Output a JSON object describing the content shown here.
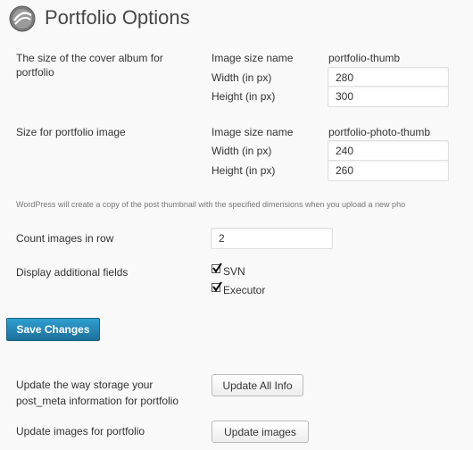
{
  "page": {
    "title": "Portfolio Options"
  },
  "cover": {
    "label": "The size of the cover album for portfolio",
    "image_size_name_label": "Image size name",
    "image_size_name_value": "portfolio-thumb",
    "width_label": "Width (in px)",
    "width_value": "280",
    "height_label": "Height (in px)",
    "height_value": "300"
  },
  "image": {
    "label": "Size for portfolio image",
    "image_size_name_label": "Image size name",
    "image_size_name_value": "portfolio-photo-thumb",
    "width_label": "Width (in px)",
    "width_value": "240",
    "height_label": "Height (in px)",
    "height_value": "260"
  },
  "note": "WordPress will create a copy of the post thumbnail with the specified dimensions when you upload a new pho",
  "count": {
    "label": "Count images in row",
    "value": "2"
  },
  "fields": {
    "label": "Display additional fields",
    "options": [
      {
        "label": "SVN",
        "checked": true
      },
      {
        "label": "Executor",
        "checked": true
      }
    ]
  },
  "save_button": "Save Changes",
  "update_storage": {
    "label": "Update the way storage your post_meta information for portfolio",
    "button": "Update All Info"
  },
  "update_images": {
    "label": "Update images for portfolio",
    "button": "Update images"
  },
  "colors": {
    "primary_button": "#2382b8",
    "background": "#f9f9f9"
  }
}
